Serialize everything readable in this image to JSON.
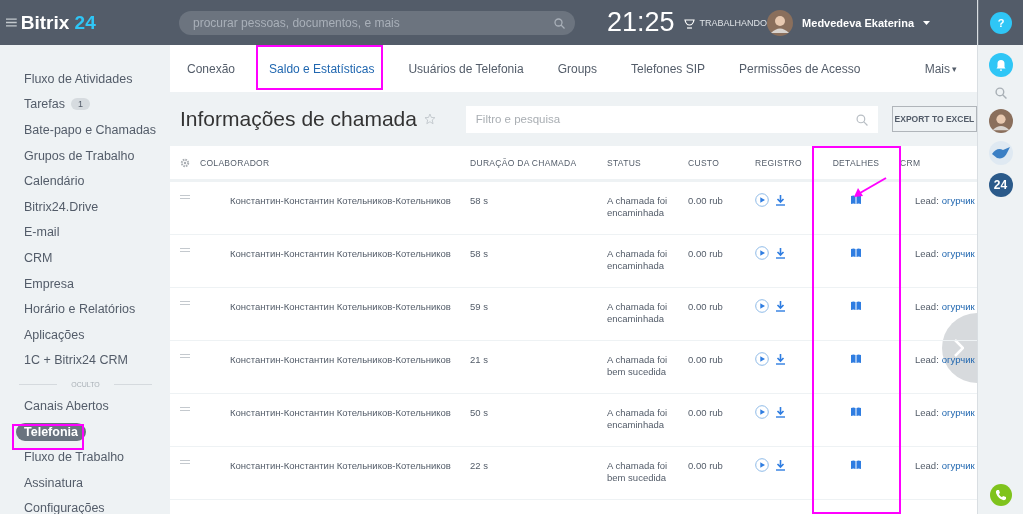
{
  "header": {
    "logo_word": "Bitrix",
    "logo_number": "24",
    "search": {
      "placeholder": "procurar pessoas, documentos, e mais"
    },
    "time": "21:25",
    "work_status": "TRABALHANDO",
    "user": "Medvedeva Ekaterina"
  },
  "sidebar": {
    "items": [
      {
        "label": "Fluxo de Atividades",
        "selected": false
      },
      {
        "label": "Tarefas",
        "selected": false,
        "badge": "1"
      },
      {
        "label": "Bate-papo e Chamadas",
        "selected": false
      },
      {
        "label": "Grupos de Trabalho",
        "selected": false
      },
      {
        "label": "Calendário",
        "selected": false
      },
      {
        "label": "Bitrix24.Drive",
        "selected": false
      },
      {
        "label": "E-mail",
        "selected": false
      },
      {
        "label": "CRM",
        "selected": false
      },
      {
        "label": "Empresa",
        "selected": false
      },
      {
        "label": "Horário e Relatórios",
        "selected": false
      },
      {
        "label": "Aplicações",
        "selected": false
      },
      {
        "label": "1C + Bitrix24 CRM",
        "selected": false
      }
    ],
    "hidden_label": "OCULTO",
    "hidden_items": [
      {
        "label": "Canais Abertos",
        "selected": false
      },
      {
        "label": "Telefonia",
        "selected": true
      },
      {
        "label": "Fluxo de Trabalho",
        "selected": false
      },
      {
        "label": "Assinatura",
        "selected": false
      },
      {
        "label": "Configurações",
        "selected": false
      }
    ]
  },
  "tabs": [
    {
      "label": "Conexão",
      "selected": false
    },
    {
      "label": "Saldo e Estatísticas",
      "selected": true
    },
    {
      "label": "Usuários de Telefonia",
      "selected": false
    },
    {
      "label": "Groups",
      "selected": false
    },
    {
      "label": "Telefones SIP",
      "selected": false
    },
    {
      "label": "Permissões de Acesso",
      "selected": false
    }
  ],
  "more_tab": "Mais",
  "more_caret": "▾",
  "page_title": "Informações de chamada",
  "filter": {
    "placeholder": "Filtro e pesquisa"
  },
  "export_button": "EXPORT TO EXCEL",
  "table": {
    "columns": [
      "COLABORADOR",
      "DURAÇÃO DA CHAMADA",
      "STATUS",
      "CUSTO",
      "REGISTRO",
      "DETALHES",
      "CRM"
    ],
    "rows": [
      {
        "employee": "Константин-Константин Котельников-Котельников",
        "duration": "58 s",
        "status": "A chamada foi encaminhada",
        "cost": "0.00 rub",
        "crm_label": "Lead:",
        "crm_link": "огурчик"
      },
      {
        "employee": "Константин-Константин Котельников-Котельников",
        "duration": "58 s",
        "status": "A chamada foi encaminhada",
        "cost": "0.00 rub",
        "crm_label": "Lead:",
        "crm_link": "огурчик"
      },
      {
        "employee": "Константин-Константин Котельников-Котельников",
        "duration": "59 s",
        "status": "A chamada foi encaminhada",
        "cost": "0.00 rub",
        "crm_label": "Lead:",
        "crm_link": "огурчик"
      },
      {
        "employee": "Константин-Константин Котельников-Котельников",
        "duration": "21 s",
        "status": "A chamada foi bem sucedida",
        "cost": "0.00 rub",
        "crm_label": "Lead:",
        "crm_link": "огурчик"
      },
      {
        "employee": "Константин-Константин Котельников-Котельников",
        "duration": "50 s",
        "status": "A chamada foi encaminhada",
        "cost": "0.00 rub",
        "crm_label": "Lead:",
        "crm_link": "огурчик"
      },
      {
        "employee": "Константин-Константин Котельников-Котельников",
        "duration": "22 s",
        "status": "A chamada foi bem sucedida",
        "cost": "0.00 rub",
        "crm_label": "Lead:",
        "crm_link": "огурчик"
      }
    ]
  },
  "right_rail": {
    "help": "?",
    "badge": "24"
  }
}
